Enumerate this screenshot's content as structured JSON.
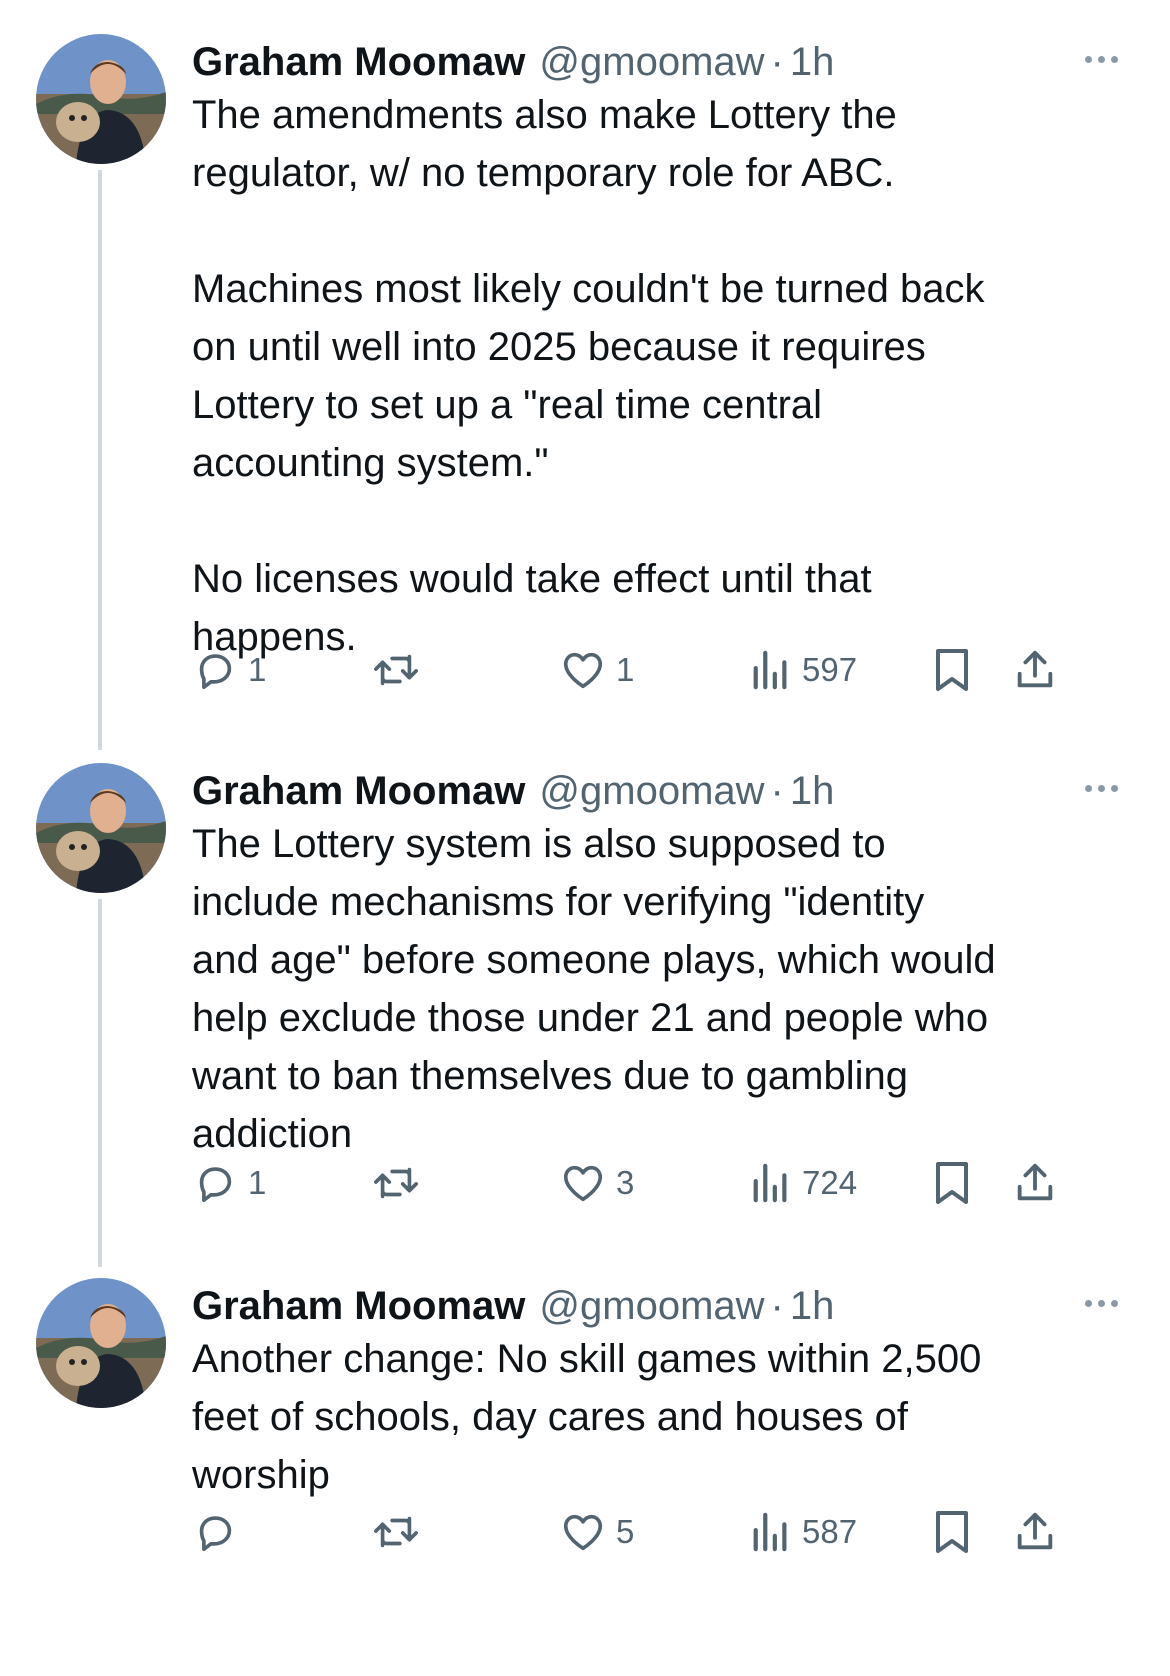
{
  "colors": {
    "text": "#0f1419",
    "secondary": "#536471",
    "thread_line": "#cfd9de"
  },
  "tweets": [
    {
      "name": "Graham Moomaw",
      "handle": "@gmoomaw",
      "separator": "·",
      "time": "1h",
      "text": "The amendments also make Lottery the\nregulator, w/ no temporary role for ABC.\n\nMachines most likely couldn't be turned back\non until well into 2025 because it requires\nLottery to set up a \"real time central\naccounting system.\"\n\nNo licenses would take effect until that\nhappens.",
      "replies": "1",
      "retweets": "",
      "likes": "1",
      "views": "597"
    },
    {
      "name": "Graham Moomaw",
      "handle": "@gmoomaw",
      "separator": "·",
      "time": "1h",
      "text": "The Lottery system is also supposed to\ninclude mechanisms for verifying \"identity\nand age\" before someone plays, which would\nhelp exclude those under 21 and people who\nwant to ban themselves due to gambling\naddiction",
      "replies": "1",
      "retweets": "",
      "likes": "3",
      "views": "724"
    },
    {
      "name": "Graham Moomaw",
      "handle": "@gmoomaw",
      "separator": "·",
      "time": "1h",
      "text": "Another change: No skill games within 2,500\nfeet of schools, day cares and houses of\nworship",
      "replies": "",
      "retweets": "",
      "likes": "5",
      "views": "587"
    }
  ],
  "icons": {
    "avatar": "profile-photo",
    "more": "more-icon",
    "reply": "reply-icon",
    "retweet": "retweet-icon",
    "like": "heart-icon",
    "views": "views-icon",
    "bookmark": "bookmark-icon",
    "share": "share-icon"
  }
}
